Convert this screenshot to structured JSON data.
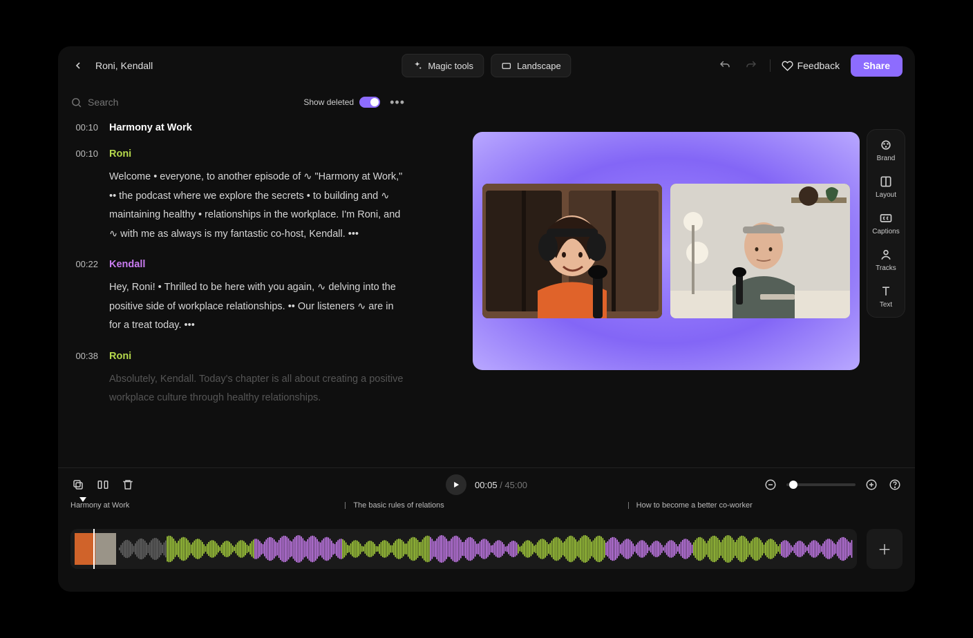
{
  "header": {
    "project_title": "Roni, Kendall",
    "magic_tools_label": "Magic tools",
    "landscape_label": "Landscape",
    "feedback_label": "Feedback",
    "share_label": "Share"
  },
  "transcript_toolbar": {
    "search_placeholder": "Search",
    "show_deleted_label": "Show deleted"
  },
  "transcript": [
    {
      "time": "00:10",
      "type": "title",
      "text": "Harmony at Work"
    },
    {
      "time": "00:10",
      "type": "speech",
      "speaker": "Roni",
      "speaker_class": "roni",
      "text": "Welcome  •  everyone, to another episode of  ∿  \"Harmony at Work,\"  ••  the podcast where we explore the secrets   •  to building and  ∿  maintaining healthy   •  relationships in the workplace. I'm Roni, and  ∿  with me as always is my fantastic co-host, Kendall.  •••"
    },
    {
      "time": "00:22",
      "type": "speech",
      "speaker": "Kendall",
      "speaker_class": "kendall",
      "text": "Hey, Roni!   •  Thrilled to be here with you again,  ∿  delving into the positive side of workplace relationships.   ••  Our listeners  ∿  are in for a treat today.  •••"
    },
    {
      "time": "00:38",
      "type": "speech",
      "speaker": "Roni",
      "speaker_class": "roni",
      "text": "Absolutely, Kendall. Today's chapter is all about creating a positive workplace culture through healthy relationships.",
      "fade": true
    }
  ],
  "side_rail": [
    {
      "label": "Brand"
    },
    {
      "label": "Layout"
    },
    {
      "label": "Captions"
    },
    {
      "label": "Tracks"
    },
    {
      "label": "Text"
    }
  ],
  "playback": {
    "current": "00:05",
    "total": "45:00"
  },
  "chapters": [
    {
      "label": "Harmony at Work",
      "left_pct": 0
    },
    {
      "label": "The basic rules of relations",
      "left_pct": 33
    },
    {
      "label": "How to become a better co-worker",
      "left_pct": 67
    }
  ],
  "colors": {
    "accent": "#8d6cfe",
    "speaker_roni": "#b6d94c",
    "speaker_kendall": "#c97cf0"
  }
}
